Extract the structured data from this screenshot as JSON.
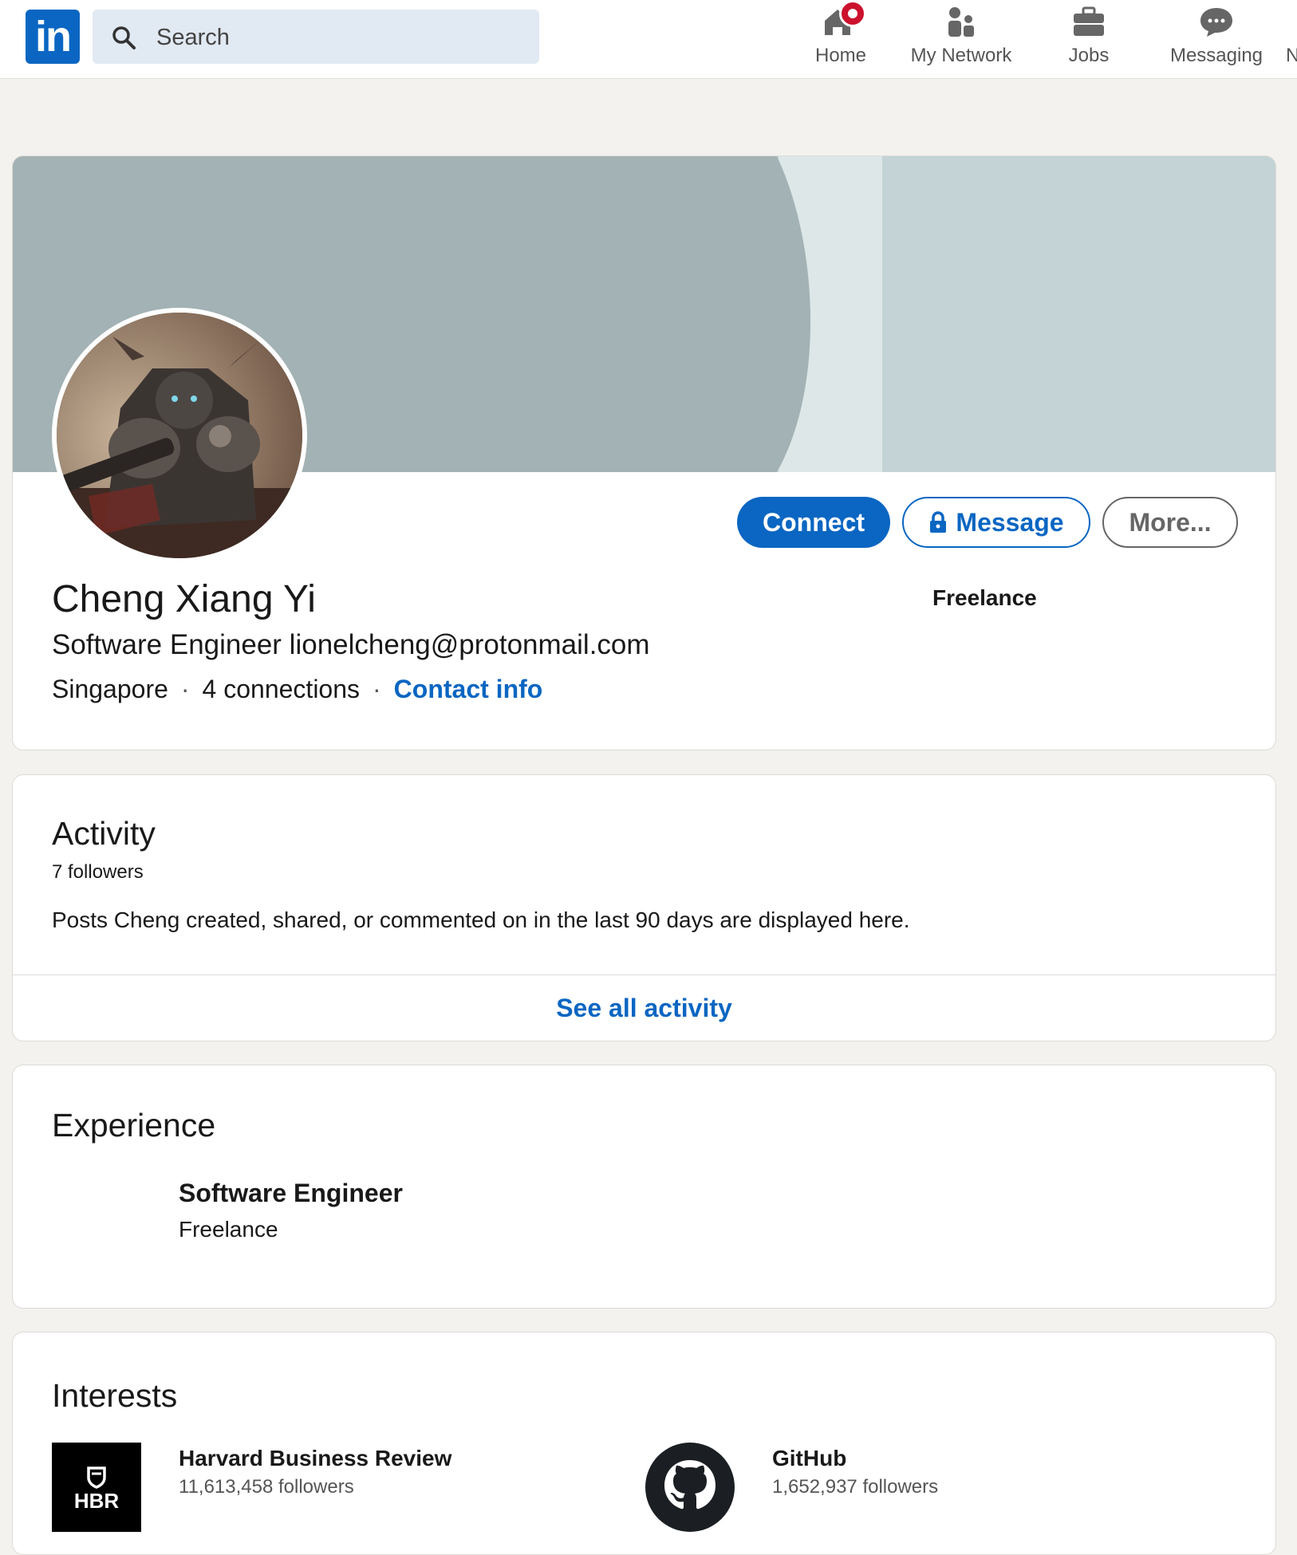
{
  "nav": {
    "logo_text": "in",
    "search_placeholder": "Search",
    "items": [
      {
        "label": "Home",
        "icon": "home-icon"
      },
      {
        "label": "My Network",
        "icon": "my-network-icon"
      },
      {
        "label": "Jobs",
        "icon": "jobs-icon"
      },
      {
        "label": "Messaging",
        "icon": "messaging-icon"
      },
      {
        "label": "N",
        "icon": ""
      }
    ]
  },
  "profile": {
    "name": "Cheng Xiang Yi",
    "headline": "Software Engineer lionelcheng@protonmail.com",
    "location": "Singapore",
    "separator": "·",
    "connections": "4 connections",
    "contact_info": "Contact info",
    "current_company": "Freelance",
    "buttons": {
      "connect": "Connect",
      "message": "Message",
      "more": "More..."
    }
  },
  "activity": {
    "title": "Activity",
    "followers": "7 followers",
    "description": "Posts Cheng created, shared, or commented on in the last 90 days are displayed here.",
    "see_all": "See all activity"
  },
  "experience": {
    "title": "Experience",
    "items": [
      {
        "title": "Software Engineer",
        "company": "Freelance"
      }
    ]
  },
  "interests": {
    "title": "Interests",
    "items": [
      {
        "name": "Harvard Business Review",
        "followers": "11,613,458 followers",
        "logo_text": "HBR"
      },
      {
        "name": "GitHub",
        "followers": "1,652,937 followers",
        "logo_text": ""
      }
    ]
  },
  "colors": {
    "brand": "#0a66c2",
    "page_bg": "#f3f2ef",
    "banner_dark": "#a3b2b4",
    "banner_light": "#c3d3d6",
    "notification": "#cb112d"
  }
}
